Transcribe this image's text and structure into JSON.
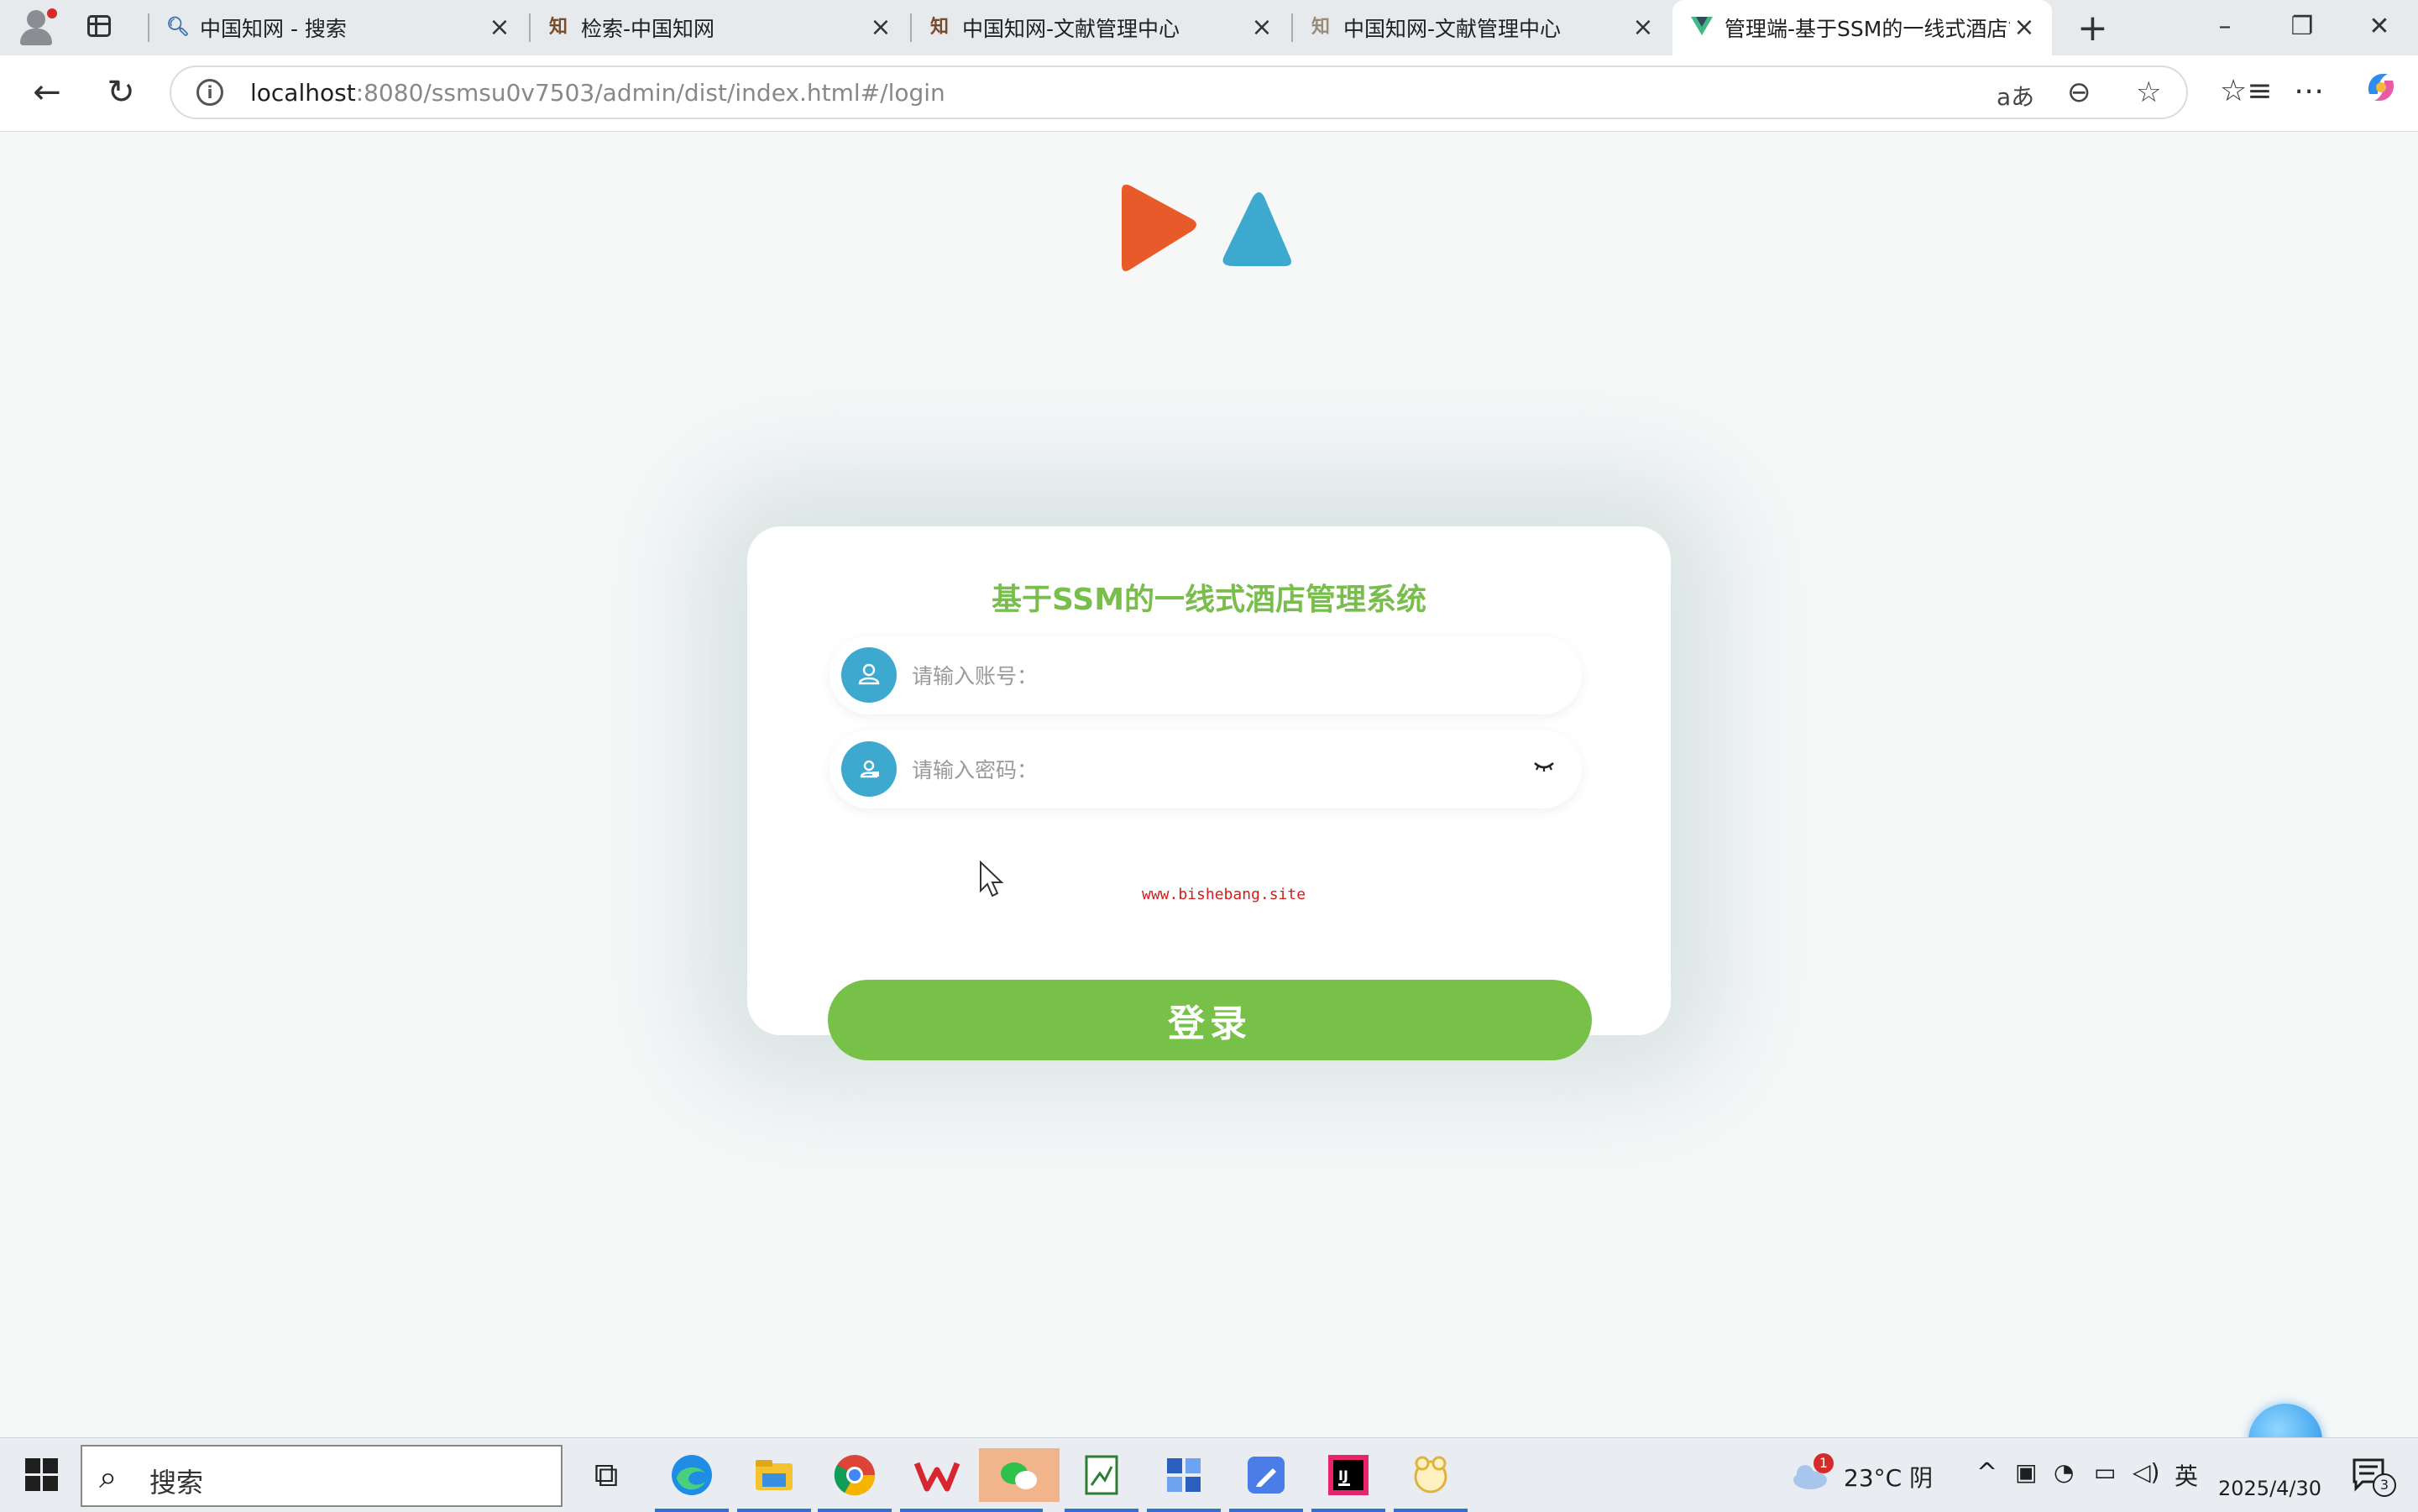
{
  "browser": {
    "tabs": [
      {
        "title": "中国知网 - 搜索",
        "icon": "search-icon",
        "active": false
      },
      {
        "title": "检索-中国知网",
        "icon": "cnki-icon",
        "active": false
      },
      {
        "title": "中国知网-文献管理中心",
        "icon": "cnki-icon",
        "active": false
      },
      {
        "title": "中国知网-文献管理中心",
        "icon": "cnki-icon",
        "active": false
      },
      {
        "title": "管理端-基于SSM的一线式酒店管",
        "icon": "vue-icon",
        "active": true
      }
    ],
    "url_host": "localhost",
    "url_rest": ":8080/ssmsu0v7503/admin/dist/index.html#/login"
  },
  "login": {
    "title": "基于SSM的一线式酒店管理系统",
    "username_placeholder": "请输入账号：",
    "password_placeholder": "请输入密码：",
    "button_label": "登录",
    "watermark": "www.bishebang.site"
  },
  "colors": {
    "title_green": "#79be4c",
    "button_green": "#78c148",
    "icon_blue": "#3da9cf",
    "logo_orange": "#e85a2a",
    "logo_blue": "#3da9cf"
  },
  "taskbar": {
    "search_label": "搜索",
    "weather": "23°C 阴",
    "weather_badge": "1",
    "ime": "英",
    "date": "2025/4/30",
    "notification_count": "3"
  }
}
